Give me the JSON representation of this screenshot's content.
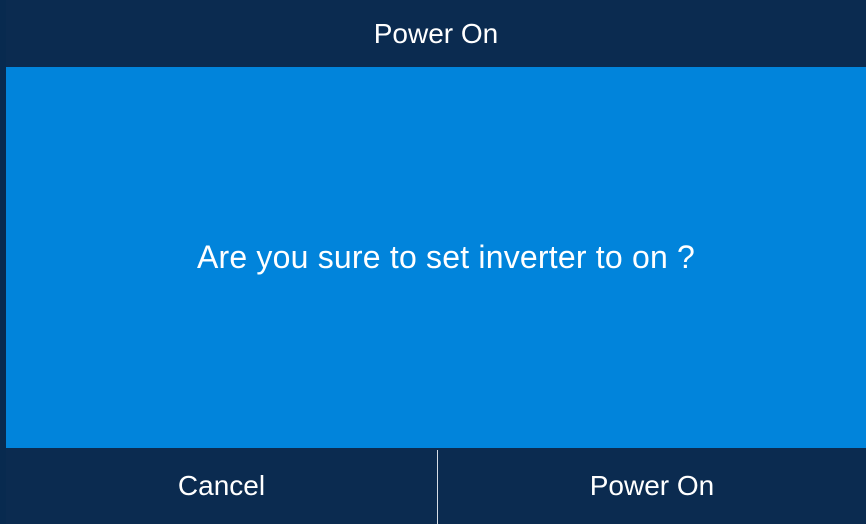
{
  "dialog": {
    "title": "Power On",
    "message": "Are you sure to set inverter to on ?",
    "cancel_label": "Cancel",
    "confirm_label": "Power On"
  },
  "colors": {
    "header_bg": "#0b2b50",
    "body_bg": "#0184db",
    "text": "#ffffff"
  }
}
